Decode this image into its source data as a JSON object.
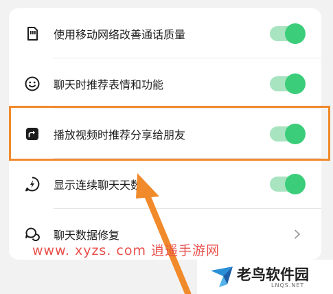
{
  "settings": [
    {
      "label": "使用移动网络改善通话质量",
      "icon": "sim-card-icon",
      "control": "toggle",
      "on": true
    },
    {
      "label": "聊天时推荐表情和功能",
      "icon": "smiley-icon",
      "control": "toggle",
      "on": true
    },
    {
      "label": "播放视频时推荐分享给朋友",
      "icon": "share-icon",
      "control": "toggle",
      "on": true
    },
    {
      "label": "显示连续聊天天数",
      "icon": "lightning-bubble-icon",
      "control": "toggle",
      "on": true
    },
    {
      "label": "聊天数据修复",
      "icon": "chat-bubbles-icon",
      "control": "chevron"
    }
  ],
  "watermark": {
    "text": "www. xyzs. com 逍遥手游网",
    "brand": "老鸟软件园",
    "brand_sub": "LNQS.NET"
  },
  "colors": {
    "toggle_on_track": "#a9e4c1",
    "toggle_on_knob": "#3ccd7b",
    "highlight": "#f18a2b",
    "watermark_red": "#e8504b"
  }
}
